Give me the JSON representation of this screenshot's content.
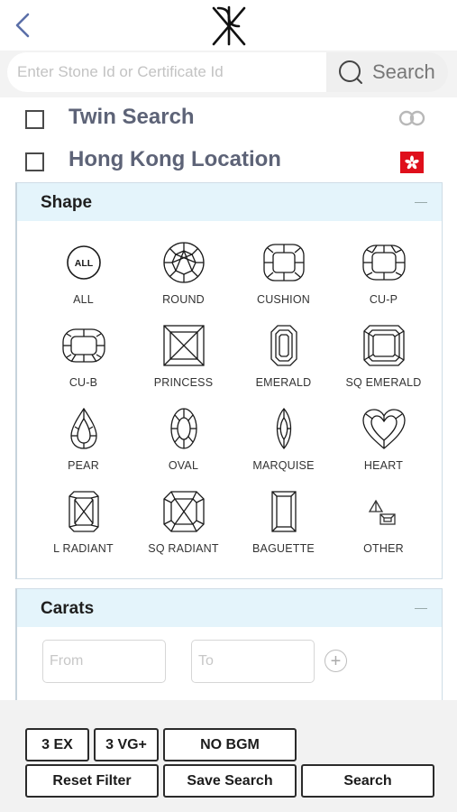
{
  "header": {
    "back_icon": "chevron-left-icon",
    "logo": "brand-monogram-logo"
  },
  "search": {
    "placeholder": "Enter Stone Id or Certificate Id",
    "value": "",
    "button_label": "Search",
    "button_icon": "search-icon"
  },
  "toggles": [
    {
      "label": "Twin Search",
      "checked": false,
      "icon": "twin-rings-icon"
    },
    {
      "label": "Hong Kong Location",
      "checked": false,
      "icon": "hong-kong-flag-icon"
    }
  ],
  "shape_panel": {
    "title": "Shape",
    "shapes": [
      {
        "label": "ALL",
        "icon_text": "ALL"
      },
      {
        "label": "ROUND"
      },
      {
        "label": "CUSHION"
      },
      {
        "label": "CU-P"
      },
      {
        "label": "CU-B"
      },
      {
        "label": "PRINCESS"
      },
      {
        "label": "EMERALD"
      },
      {
        "label": "SQ EMERALD"
      },
      {
        "label": "PEAR"
      },
      {
        "label": "OVAL"
      },
      {
        "label": "MARQUISE"
      },
      {
        "label": "HEART"
      },
      {
        "label": "L RADIANT"
      },
      {
        "label": "SQ RADIANT"
      },
      {
        "label": "BAGUETTE"
      },
      {
        "label": "OTHER"
      }
    ]
  },
  "carats_panel": {
    "title": "Carats",
    "from_placeholder": "From",
    "to_placeholder": "To",
    "add_icon": "plus-circle-icon"
  },
  "bottom": {
    "quick_filters": [
      "3 EX",
      "3 VG+",
      "NO BGM"
    ],
    "reset_label": "Reset Filter",
    "save_label": "Save Search",
    "search_label": "Search"
  },
  "colors": {
    "accent_text": "#5d6377",
    "panel_header_bg": "#e4f4fb",
    "flag_red": "#df0f1b"
  }
}
